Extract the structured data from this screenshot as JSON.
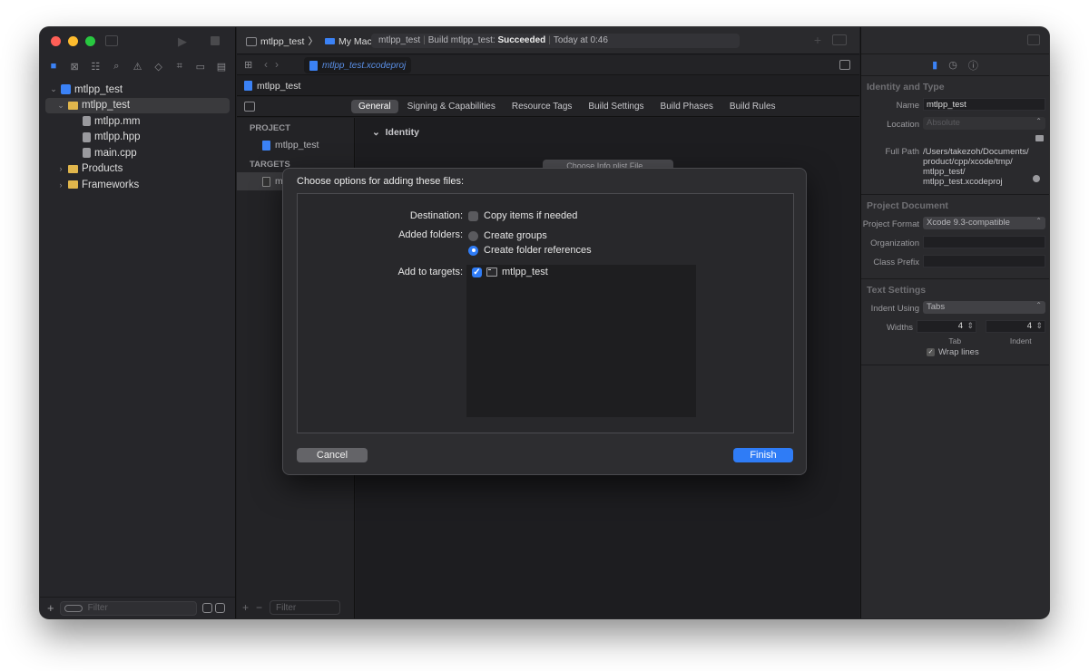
{
  "toolbar": {
    "scheme_name": "mtlpp_test",
    "destination": "My Mac",
    "activity": {
      "project": "mtlpp_test",
      "build_prefix": "Build mtlpp_test:",
      "status": "Succeeded",
      "time": "Today at 0:46"
    }
  },
  "editor_tab": {
    "file": "mtlpp_test.xcodeproj"
  },
  "jumpbar": {
    "item": "mtlpp_test"
  },
  "navigator": {
    "items": [
      {
        "label": "mtlpp_test",
        "level": 0,
        "icon": "project-icon"
      },
      {
        "label": "mtlpp_test",
        "level": 1,
        "icon": "folder-icon"
      },
      {
        "label": "mtlpp.mm",
        "level": 2,
        "icon": "file-icon"
      },
      {
        "label": "mtlpp.hpp",
        "level": 2,
        "icon": "file-icon"
      },
      {
        "label": "main.cpp",
        "level": 2,
        "icon": "file-icon"
      },
      {
        "label": "Products",
        "level": 1,
        "icon": "folder-icon"
      },
      {
        "label": "Frameworks",
        "level": 1,
        "icon": "folder-icon"
      }
    ],
    "filter_placeholder": "Filter"
  },
  "editor_tabs": {
    "tabs": [
      "General",
      "Signing & Capabilities",
      "Resource Tags",
      "Build Settings",
      "Build Phases",
      "Build Rules"
    ],
    "active": "General"
  },
  "project_list": {
    "project_header": "PROJECT",
    "project_item": "mtlpp_test",
    "targets_header": "TARGETS",
    "target_item": "mt",
    "filter_placeholder": "Filter"
  },
  "editor": {
    "identity_heading": "Identity",
    "choose_button": "Choose Info.plist File..."
  },
  "inspector": {
    "identity_title": "Identity and Type",
    "name_label": "Name",
    "name_value": "mtlpp_test",
    "location_label": "Location",
    "location_value": "Absolute",
    "fullpath_label": "Full Path",
    "fullpath_lines": [
      "/Users/takezoh/Documents/",
      "product/cpp/xcode/tmp/",
      "mtlpp_test/",
      "mtlpp_test.xcodeproj"
    ],
    "project_doc_title": "Project Document",
    "format_label": "Project Format",
    "format_value": "Xcode 9.3-compatible",
    "org_label": "Organization",
    "prefix_label": "Class Prefix",
    "text_settings_title": "Text Settings",
    "indent_label": "Indent Using",
    "indent_value": "Tabs",
    "widths_label": "Widths",
    "tab_width": "4",
    "indent_width": "4",
    "tab_caption": "Tab",
    "indent_caption": "Indent",
    "wrap_label": "Wrap lines"
  },
  "dialog": {
    "title": "Choose options for adding these files:",
    "destination_label": "Destination:",
    "copy_items_label": "Copy items if needed",
    "added_folders_label": "Added folders:",
    "create_groups_label": "Create groups",
    "create_folder_refs_label": "Create folder references",
    "add_targets_label": "Add to targets:",
    "target_name": "mtlpp_test",
    "cancel_label": "Cancel",
    "finish_label": "Finish"
  },
  "colors": {
    "accent": "#2f7cf6",
    "window_bg": "#1f1f22",
    "sheet_bg": "#2d2d30"
  }
}
